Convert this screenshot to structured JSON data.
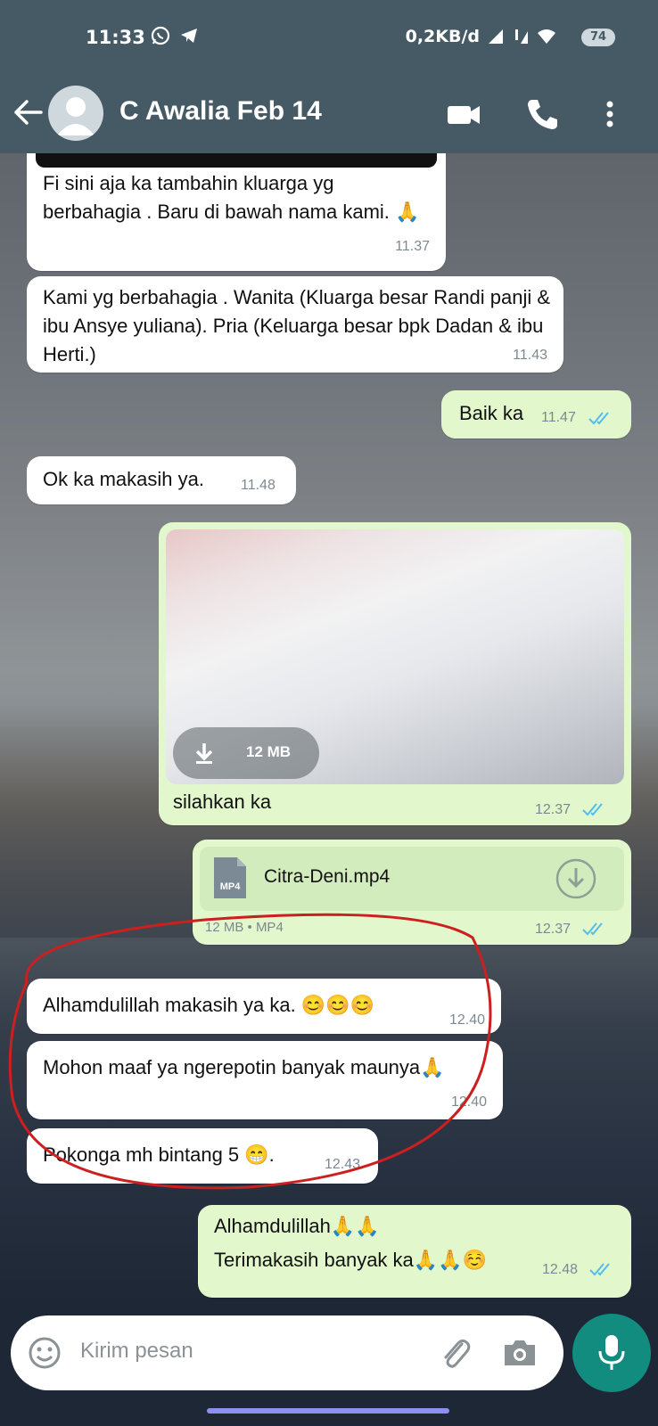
{
  "status_bar": {
    "time": "11:33",
    "network_speed": "0,2KB/d",
    "battery": "74"
  },
  "header": {
    "contact_name": "C Awalia Feb 14"
  },
  "messages": [
    {
      "text": "Fi sini aja ka tambahin kluarga yg berbahagia . Baru di bawah nama kami. 🙏",
      "time": "11.37"
    },
    {
      "text": "Kami yg berbahagia .  Wanita (Kluarga besar Randi panji & ibu Ansye yuliana).  Pria (Keluarga besar bpk Dadan & ibu Herti.)",
      "time": "11.43"
    },
    {
      "text": "Baik ka",
      "time": "11.47"
    },
    {
      "text": "Ok ka makasih ya.",
      "time": "11.48"
    },
    {
      "video_size": "12 MB",
      "caption": "silahkan ka",
      "time": "12.37"
    },
    {
      "file_badge": "MP4",
      "file_name": "Citra-Deni.mp4",
      "file_meta": "12 MB • MP4",
      "time": "12.37"
    },
    {
      "text": "Alhamdulillah makasih ya ka. 😊😊😊",
      "time": "12.40"
    },
    {
      "text": "Mohon maaf ya ngerepotin banyak maunya🙏",
      "time": "12.40"
    },
    {
      "text": "Pokonga mh bintang 5 😁.",
      "time": "12.43"
    },
    {
      "line1": "Alhamdulillah🙏🙏",
      "line2": "Terimakasih banyak ka🙏🙏☺️",
      "time": "12.48"
    }
  ],
  "composer": {
    "placeholder": "Kirim pesan"
  },
  "colors": {
    "header": "#455a64",
    "outgoing_bubble": "#e2f7cb",
    "incoming_bubble": "#ffffff",
    "accent": "#128c7e",
    "read_ticks": "#53bdeb",
    "annotation": "#cc1f1f"
  }
}
